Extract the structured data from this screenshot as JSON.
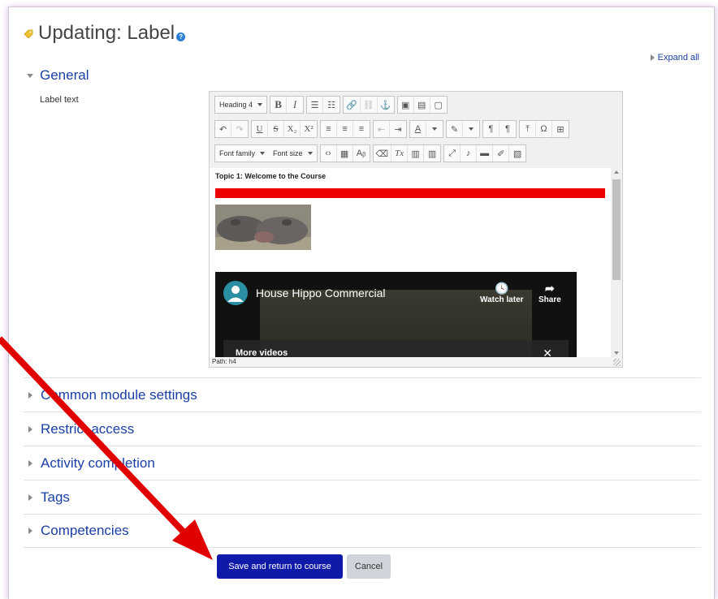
{
  "page": {
    "title": "Updating: Label",
    "expand_all": "Expand all"
  },
  "general": {
    "heading": "General",
    "label_text": "Label text"
  },
  "editor": {
    "heading_select": "Heading 4",
    "font_family_select": "Font family",
    "font_size_select": "Font size",
    "content_heading": "Topic 1: Welcome to the Course",
    "path": "Path: h4",
    "video": {
      "title": "House Hippo Commercial",
      "watch_later": "Watch later",
      "share": "Share",
      "more_videos": "More videos"
    }
  },
  "sections": [
    {
      "label": "Common module settings"
    },
    {
      "label": "Restrict access"
    },
    {
      "label": "Activity completion"
    },
    {
      "label": "Tags"
    },
    {
      "label": "Competencies"
    }
  ],
  "buttons": {
    "save": "Save and return to course",
    "cancel": "Cancel"
  },
  "colors": {
    "link": "#1a3fa6",
    "primary_button": "#0f1aa8",
    "annotation_arrow": "#e00000",
    "red_bar": "#ee0000"
  }
}
